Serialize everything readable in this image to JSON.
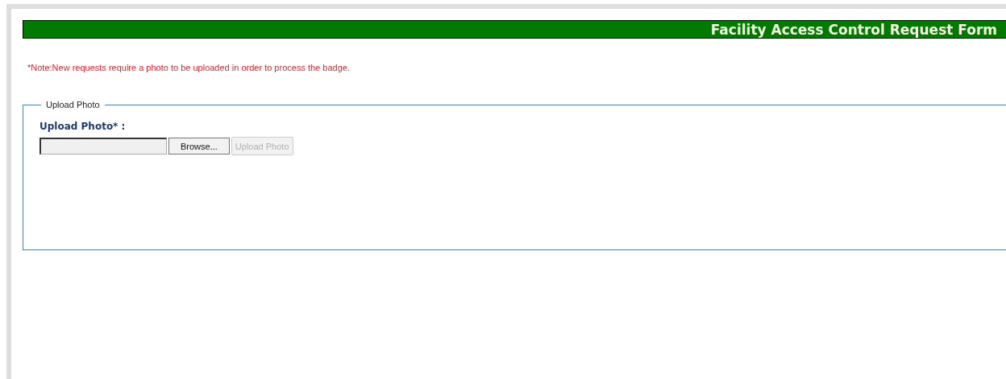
{
  "header": {
    "title": "Facility Access Control Request Form"
  },
  "note": "*Note:New requests require a photo to be uploaded in order to process the badge.",
  "fieldset": {
    "legend": "Upload Photo",
    "label": "Upload Photo* :",
    "buttons": [
      {
        "label": "Browse...",
        "disabled": false
      },
      {
        "label": "Upload Photo",
        "disabled": true
      }
    ]
  }
}
